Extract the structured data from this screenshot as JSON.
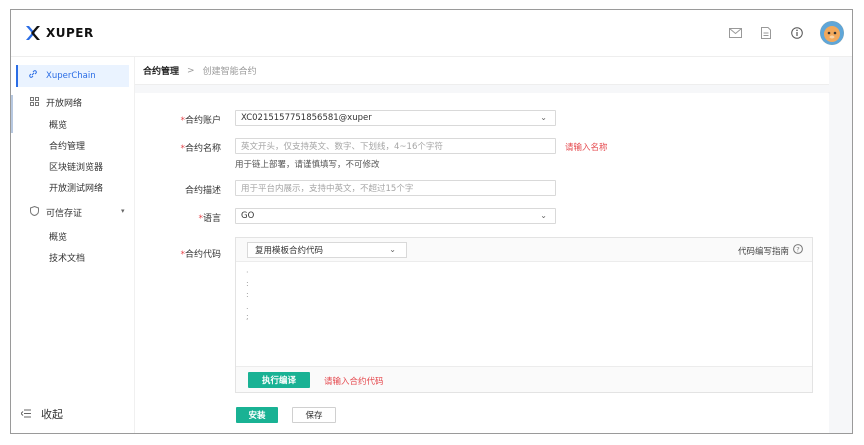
{
  "header": {
    "logo_text": "XUPER",
    "icons": [
      "mail-icon",
      "document-icon",
      "info-icon",
      "avatar"
    ]
  },
  "sidebar": {
    "active_item": "XuperChain",
    "groups": [
      {
        "label": "开放网络",
        "items": [
          "概览",
          "合约管理",
          "区块链浏览器",
          "开放测试网络"
        ]
      },
      {
        "label": "可信存证",
        "items": [
          "概览",
          "技术文档"
        ]
      }
    ],
    "collapse_label": "收起"
  },
  "breadcrumb": {
    "parent": "合约管理",
    "separator": ">",
    "current": "创建智能合约"
  },
  "form": {
    "account": {
      "label": "合约账户",
      "value": "XC0215157751856581@xuper"
    },
    "name": {
      "label": "合约名称",
      "placeholder": "英文开头，仅支持英文、数字、下划线，4~16个字符",
      "error": "请输入名称",
      "hint": "用于链上部署，请谨慎填写，不可修改"
    },
    "description": {
      "label": "合约描述",
      "placeholder": "用于平台内展示，支持中英文，不超过15个字"
    },
    "language": {
      "label": "语言",
      "value": "GO"
    },
    "code": {
      "label": "合约代码",
      "template_select": "复用模板合约代码",
      "guide": "代码编写指南",
      "compile_button": "执行编译",
      "error": "请输入合约代码"
    },
    "install_button": "安装",
    "save_button": "保存"
  },
  "colors": {
    "primary": "#2b6de5",
    "green": "#19b294",
    "error": "#e5484d",
    "active_bg": "#eaf3ff"
  }
}
